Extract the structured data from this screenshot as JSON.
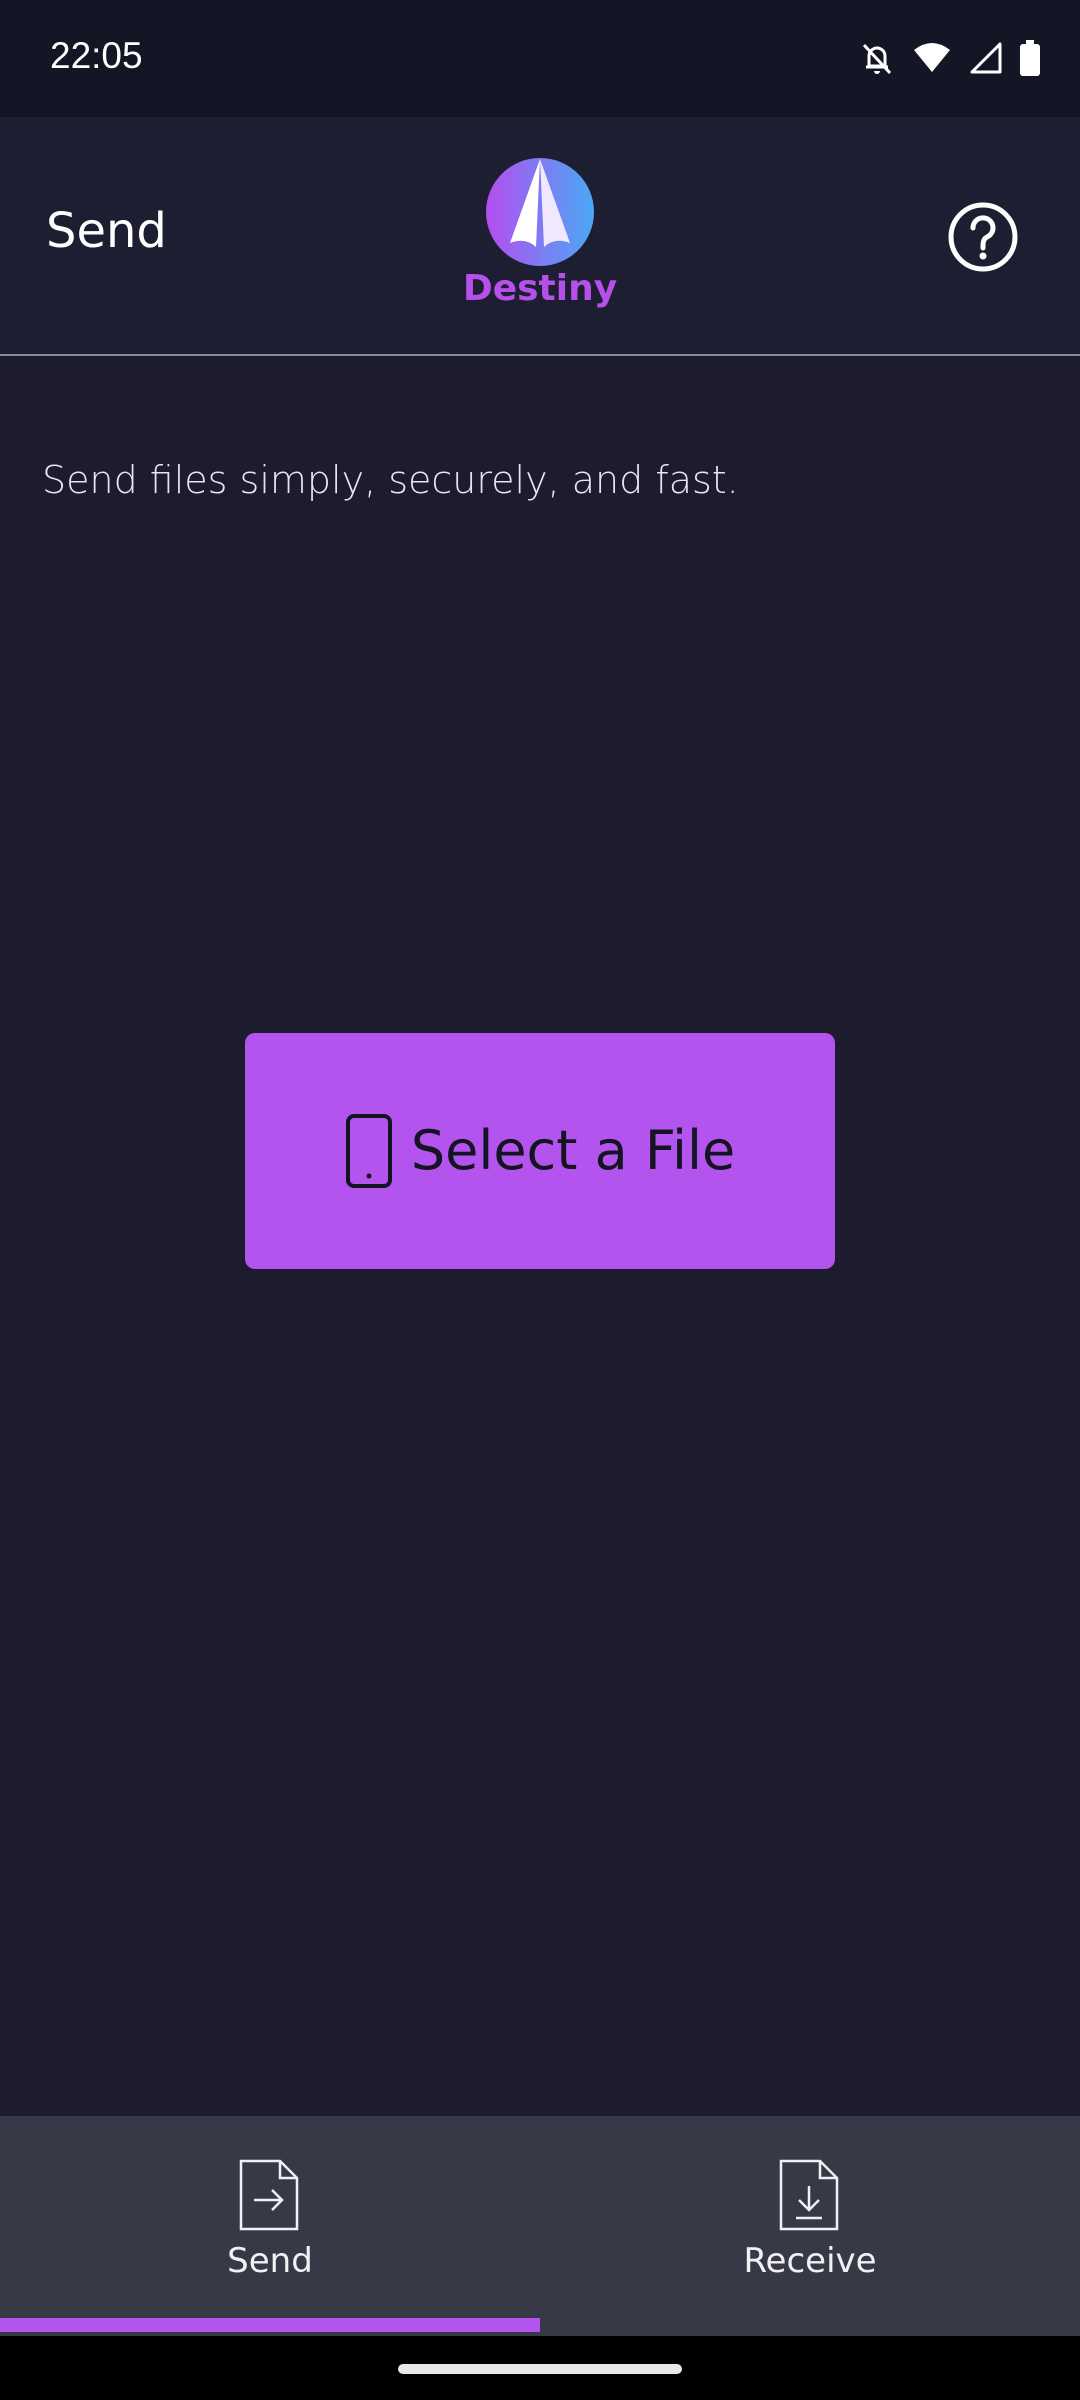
{
  "status_bar": {
    "time": "22:05",
    "icons": [
      "notifications-off-icon",
      "wifi-icon",
      "cell-signal-icon",
      "battery-icon"
    ]
  },
  "header": {
    "title": "Send",
    "logo_text": "Destiny",
    "help_icon": "help-circle-icon"
  },
  "main": {
    "tagline": "Send files simply, securely, and fast.",
    "select_button": {
      "label": "Select a File",
      "icon": "phone-icon"
    }
  },
  "bottom_nav": {
    "tabs": [
      {
        "label": "Send",
        "icon": "send-file-icon",
        "selected": true
      },
      {
        "label": "Receive",
        "icon": "receive-file-icon",
        "selected": false
      }
    ]
  },
  "colors": {
    "background": "#1c1c2e",
    "accent": "#b454ef",
    "nav_background": "#383946"
  }
}
